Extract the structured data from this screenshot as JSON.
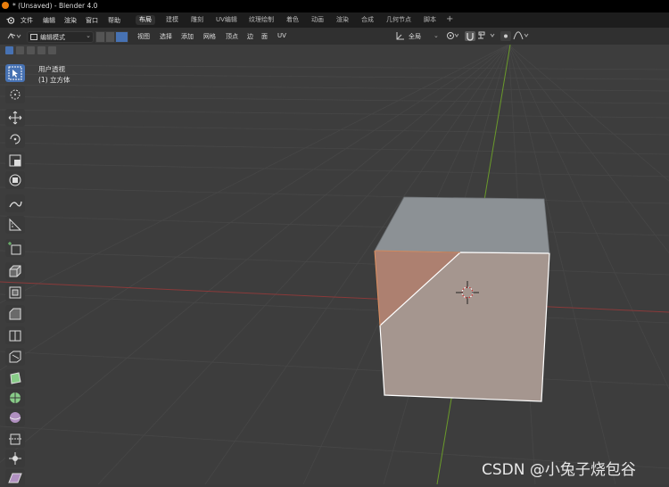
{
  "window": {
    "title": "* (Unsaved) - Blender 4.0"
  },
  "menu": {
    "items": [
      "文件",
      "编辑",
      "渲染",
      "窗口",
      "帮助"
    ]
  },
  "workspace_tabs": [
    "布局",
    "建模",
    "雕刻",
    "UV编辑",
    "纹理绘制",
    "着色",
    "动画",
    "渲染",
    "合成",
    "几何节点",
    "脚本"
  ],
  "workspace_add": "+",
  "header": {
    "mode": "编辑模式",
    "menus": [
      "视图",
      "选择",
      "添加",
      "网格",
      "顶点",
      "边",
      "面",
      "UV"
    ],
    "transform_orientation": "全局"
  },
  "viewport": {
    "view_name": "用户透视",
    "object_name": "(1) 立方体"
  },
  "tools": [
    "select-box",
    "cursor",
    "move",
    "rotate",
    "scale",
    "transform",
    "annotate",
    "measure",
    "add-cube",
    "extrude-region",
    "inset-faces",
    "bevel",
    "loop-cut",
    "knife",
    "poly-build",
    "spin",
    "smooth",
    "edge-slide",
    "shrink-fatten",
    "shear"
  ],
  "colors": {
    "accent": "#4772b3",
    "x_axis": "#8a3a3a",
    "y_axis": "#6a9a2a",
    "selected_edge": "#ffffff",
    "active_face": "#f0a070"
  },
  "watermark": "CSDN @小兔子烧包谷"
}
